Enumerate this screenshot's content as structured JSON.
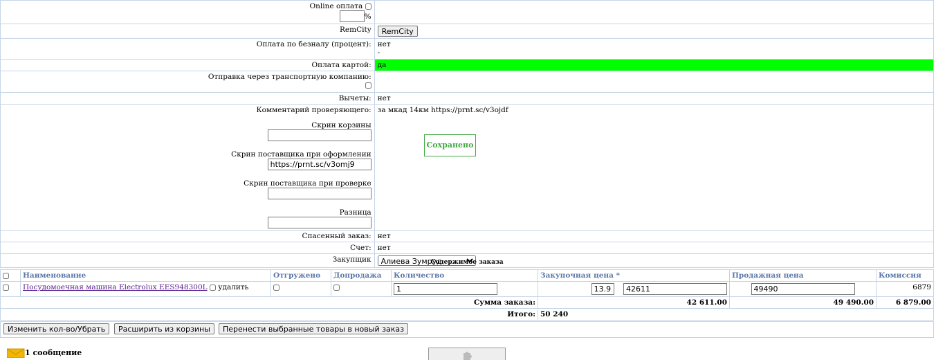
{
  "rows": {
    "online_payment": {
      "label": "Online оплата",
      "percent_suffix": "%",
      "percent_value": ""
    },
    "remcity": {
      "label": "RemCity",
      "button": "RemCity"
    },
    "cashless": {
      "label": "Оплата по безналу (процент):",
      "value": "нет",
      "value2": "-"
    },
    "card": {
      "label": "Оплата картой:",
      "value": "да"
    },
    "transport": {
      "label": "Отправка через транспортную компанию:"
    },
    "deductions": {
      "label": "Вычеты:",
      "value": "нет"
    },
    "comment": {
      "label": "Комментарий проверяющего:",
      "value": "за мкад 14км https://prnt.sc/v3ojdf"
    },
    "screens": {
      "cart_label": "Скрин корзины",
      "cart_value": "",
      "supplier_label": "Скрин поставщика при оформлении",
      "supplier_value": "https://prnt.sc/v3omj9",
      "check_label": "Скрин поставщика при проверке",
      "check_value": "",
      "diff_label": "Разница",
      "diff_value": ""
    },
    "saved": "Сохранено",
    "saved_order": {
      "label": "Спасенный заказ:",
      "value": "нет"
    },
    "invoice": {
      "label": "Счет:",
      "value": "нет"
    },
    "buyer": {
      "label": "Закупщик",
      "value": "Алиева Зумруд"
    }
  },
  "order": {
    "title": "Содержимое заказа",
    "columns": [
      "Наименование",
      "Отгружено",
      "Допродажа",
      "Количество",
      "Закупочная цена *",
      "Продажная цена",
      "Комиссия"
    ],
    "item": {
      "name": "Посудомоечная машина Electrolux EES948300L",
      "delete": "удалить",
      "qty": "1",
      "rate": "13.9",
      "purchase": "42611",
      "sale": "49490",
      "commission": "6879"
    },
    "sum_label": "Сумма заказа:",
    "sum_purchase": "42 611.00",
    "sum_sale": "49 490.00",
    "sum_commission": "6 879.00",
    "total_label": "Итого:",
    "total": "50 240"
  },
  "buttons": {
    "change": "Изменить кол-во/Убрать",
    "expand": "Расширить из корзины",
    "move": "Перенести выбранные товары в новый заказ"
  },
  "messages": "1 сообщение"
}
